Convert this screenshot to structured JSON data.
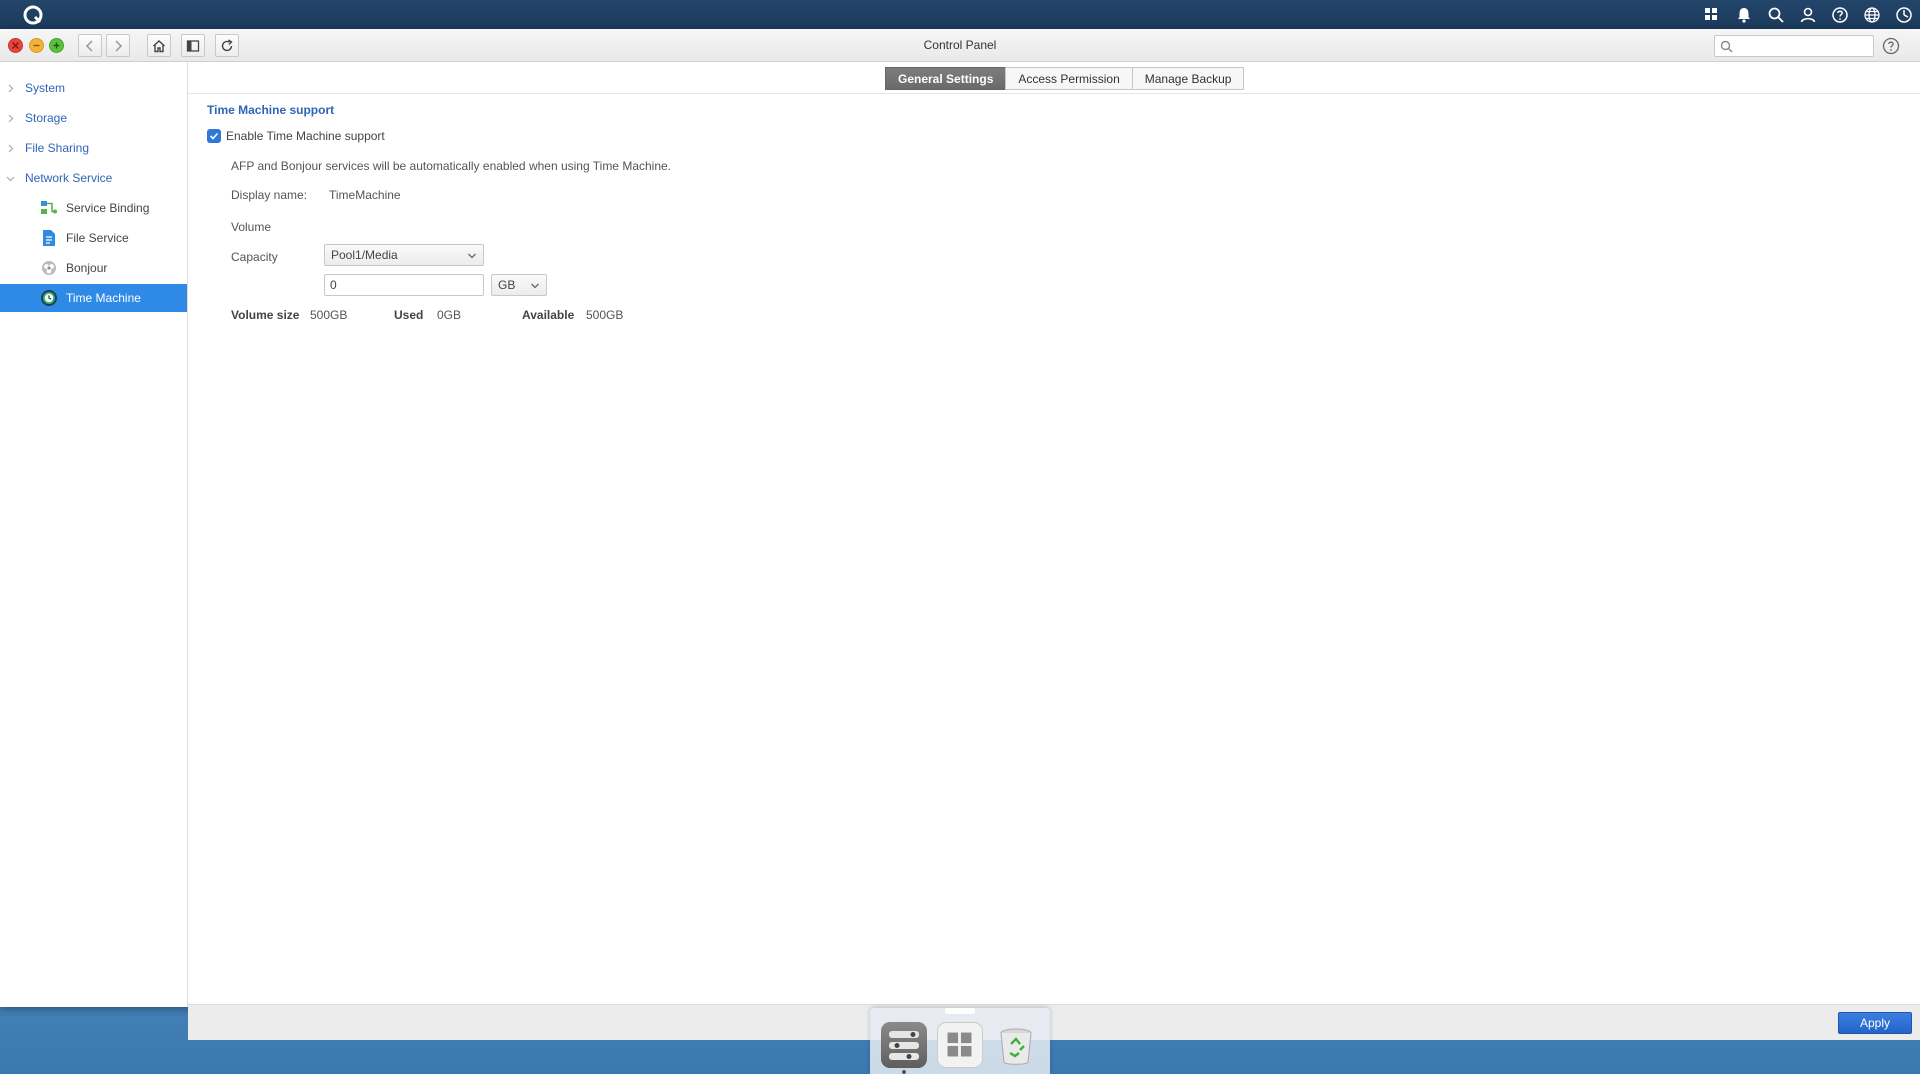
{
  "window": {
    "title": "Control Panel",
    "search_placeholder": ""
  },
  "sidebar": {
    "items": [
      {
        "label": "System",
        "expanded": false
      },
      {
        "label": "Storage",
        "expanded": false
      },
      {
        "label": "File Sharing",
        "expanded": false
      },
      {
        "label": "Network Service",
        "expanded": true
      }
    ],
    "sub_items": [
      {
        "label": "Service Binding",
        "icon": "service-binding-icon"
      },
      {
        "label": "File Service",
        "icon": "file-service-icon"
      },
      {
        "label": "Bonjour",
        "icon": "bonjour-icon"
      },
      {
        "label": "Time Machine",
        "icon": "time-machine-icon",
        "active": true
      }
    ]
  },
  "tabs": [
    {
      "label": "General Settings",
      "active": true
    },
    {
      "label": "Access Permission",
      "active": false
    },
    {
      "label": "Manage Backup",
      "active": false
    }
  ],
  "general": {
    "section_title": "Time Machine support",
    "enable_label": "Enable Time Machine support",
    "enable_checked": true,
    "info": "AFP and Bonjour services will be automatically enabled when using Time Machine.",
    "display_name_label": "Display name:",
    "display_name_value": "TimeMachine",
    "volume_label": "Volume",
    "volume_value": "Pool1/Media",
    "capacity_label": "Capacity",
    "capacity_value": "0",
    "capacity_unit": "GB",
    "volume_size_label": "Volume size",
    "volume_size_value": "500GB",
    "used_label": "Used",
    "used_value": "0GB",
    "available_label": "Available",
    "available_value": "500GB"
  },
  "footer": {
    "apply_label": "Apply"
  },
  "colors": {
    "accent": "#2e8ae6",
    "link": "#2f65b7",
    "apply": "#2563c9"
  }
}
